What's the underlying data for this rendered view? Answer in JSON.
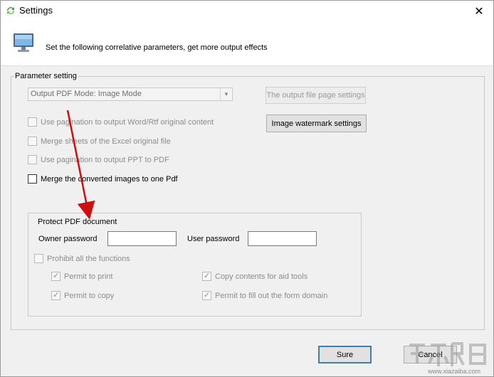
{
  "window": {
    "title": "Settings",
    "close_glyph": "✕",
    "icons": {
      "app": "refresh-arrows-icon",
      "close": "close-icon",
      "header": "monitor-icon"
    }
  },
  "header": {
    "description": "Set the following correlative parameters, get more output effects"
  },
  "parameter_setting": {
    "legend": "Parameter setting",
    "output_mode": {
      "selected": "Output PDF Mode: Image Mode"
    },
    "buttons": {
      "page_settings": "The output file page settings",
      "watermark": "Image watermark settings"
    },
    "options": [
      {
        "label": "Use pagination to output Word/Rtf original content",
        "checked": false,
        "enabled": false
      },
      {
        "label": "Merge sheets of the Excel original file",
        "checked": false,
        "enabled": false
      },
      {
        "label": "Use pagination to output PPT to PDF",
        "checked": false,
        "enabled": false
      },
      {
        "label": "Merge the converted images to one Pdf",
        "checked": false,
        "enabled": true
      }
    ]
  },
  "protect_pdf": {
    "legend": "Protect PDF document",
    "owner_password_label": "Owner password",
    "owner_password_value": "",
    "user_password_label": "User password",
    "user_password_value": "",
    "prohibit_all": {
      "label": "Prohibit all the functions",
      "checked": false
    },
    "permissions": [
      {
        "label": "Permit to print",
        "checked": true
      },
      {
        "label": "Copy contents for aid tools",
        "checked": true
      },
      {
        "label": "Permit to copy",
        "checked": true
      },
      {
        "label": "Permit to fill out the form domain",
        "checked": true
      }
    ]
  },
  "footer": {
    "ok_label": "Sure",
    "cancel_label": "Cancel"
  },
  "watermark": {
    "url": "www.xiazaiba.com"
  },
  "colors": {
    "annotation_arrow": "#cc1010",
    "default_button_border": "#3c7fb1"
  }
}
